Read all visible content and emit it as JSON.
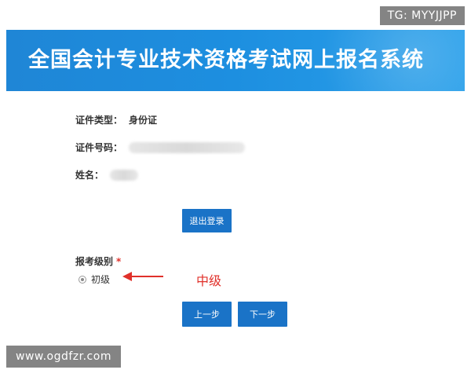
{
  "watermarks": {
    "top": "TG: MYYJJPP",
    "bottom": "www.ogdfzr.com"
  },
  "banner": {
    "title": "全国会计专业技术资格考试网上报名系统"
  },
  "info": {
    "id_type_label": "证件类型：",
    "id_type_value": "身份证",
    "id_number_label": "证件号码：",
    "name_label": "姓名："
  },
  "buttons": {
    "logout": "退出登录",
    "prev": "上一步",
    "next": "下一步"
  },
  "level": {
    "label": "报考级别",
    "required_mark": "*",
    "option_label": "初级",
    "annotation": "中级"
  },
  "colors": {
    "banner": "#1d8fe0",
    "button": "#1a73c7",
    "annotation": "#e0302a"
  }
}
